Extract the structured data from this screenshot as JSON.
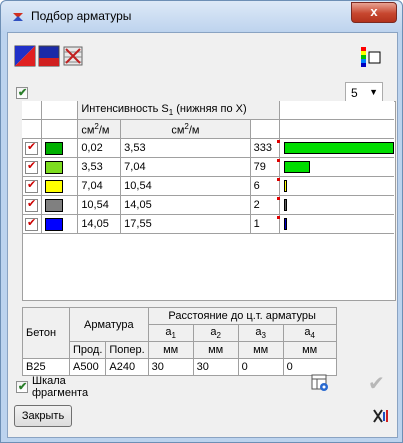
{
  "window": {
    "title": "Подбор арматуры",
    "close_label": "x"
  },
  "toolbar": {
    "icons": [
      "red-blue-diagonal-icon",
      "blue-red-fill-icon",
      "striped-grid-icon",
      "colorbar-icon"
    ]
  },
  "top_checkbox": {
    "checked": true
  },
  "level_select": {
    "value": "5"
  },
  "table": {
    "header_main": "Интенсивность S",
    "header_sub": "1",
    "header_rest": " (нижняя по X)",
    "unit_from": "см",
    "unit_to": "см",
    "unit_exp": "2",
    "unit_per": "/м",
    "rows": [
      {
        "color": "#00b000",
        "from": "0,02",
        "to": "3,53",
        "count": "333",
        "bar_fraction": 1.0,
        "bar_color": "#00dd00"
      },
      {
        "color": "#7ddc1f",
        "from": "3,53",
        "to": "7,04",
        "count": "79",
        "bar_fraction": 0.24,
        "bar_color": "#00dd00"
      },
      {
        "color": "#ffff00",
        "from": "7,04",
        "to": "10,54",
        "count": "6",
        "bar_fraction": 0.02,
        "bar_color": "#ffff00"
      },
      {
        "color": "#808080",
        "from": "10,54",
        "to": "14,05",
        "count": "2",
        "bar_fraction": 0.006,
        "bar_color": "#606060"
      },
      {
        "color": "#0000ff",
        "from": "14,05",
        "to": "17,55",
        "count": "1",
        "bar_fraction": 0.003,
        "bar_color": "#0000cc"
      }
    ]
  },
  "rebar": {
    "concrete_label": "Бетон",
    "rebar_label": "Арматура",
    "distance_label": "Расстояние до ц.т. арматуры",
    "long_label": "Прод.",
    "trans_label": "Попер.",
    "a_labels": [
      "a",
      "a",
      "a",
      "a"
    ],
    "a_subs": [
      "1",
      "2",
      "3",
      "4"
    ],
    "unit": "мм",
    "values": {
      "concrete": "B25",
      "long": "A500",
      "trans": "A240",
      "a1": "30",
      "a2": "30",
      "a3": "0",
      "a4": "0"
    }
  },
  "bottom": {
    "scale_label_1": "Шкала",
    "scale_label_2": "фрагмента",
    "close_button": "Закрыть"
  }
}
